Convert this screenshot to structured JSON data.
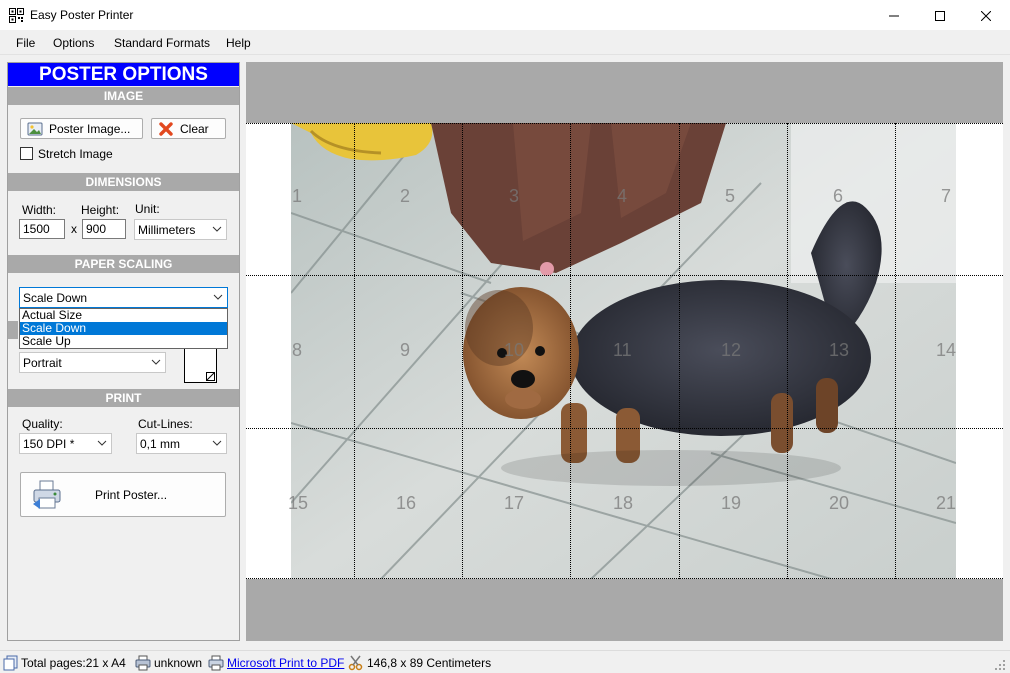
{
  "window": {
    "title": "Easy Poster Printer",
    "icons": {
      "app": "grid-app-icon",
      "minimize": "minimize-icon",
      "maximize": "maximize-icon",
      "close": "close-icon"
    }
  },
  "menu": {
    "items": [
      "File",
      "Options",
      "Standard Formats",
      "Help"
    ]
  },
  "panel": {
    "title": "POSTER OPTIONS",
    "image": {
      "header": "IMAGE",
      "poster_image_label": "Poster Image...",
      "clear_label": "Clear",
      "stretch_label": "Stretch Image",
      "stretch_checked": false
    },
    "dimensions": {
      "header": "DIMENSIONS",
      "width_label": "Width:",
      "height_label": "Height:",
      "unit_label": "Unit:",
      "width_value": "1500",
      "times": "x",
      "height_value": "900",
      "unit_value": "Millimeters"
    },
    "paper_scaling": {
      "header": "PAPER SCALING",
      "selected": "Scale Down",
      "options": [
        "Actual Size",
        "Scale Down",
        "Scale Up"
      ],
      "orientation_value": "Portrait"
    },
    "print": {
      "header": "PRINT",
      "quality_label": "Quality:",
      "cutlines_label": "Cut-Lines:",
      "quality_value": "150 DPI *",
      "cutlines_value": "0,1 mm",
      "print_label": "Print Poster..."
    }
  },
  "preview": {
    "tiles": [
      "1",
      "2",
      "3",
      "4",
      "5",
      "6",
      "7",
      "8",
      "9",
      "10",
      "11",
      "12",
      "13",
      "14",
      "15",
      "16",
      "17",
      "18",
      "19",
      "20",
      "21"
    ],
    "columns": 7,
    "rows": 3
  },
  "status": {
    "total_pages": "Total pages:21 x A4",
    "unknown": "unknown",
    "printer": "Microsoft Print to PDF",
    "size": "146,8 x 89 Centimeters"
  },
  "colors": {
    "accent": "#0000ff",
    "section_header": "#a9a9a9",
    "selection": "#0078d7"
  }
}
